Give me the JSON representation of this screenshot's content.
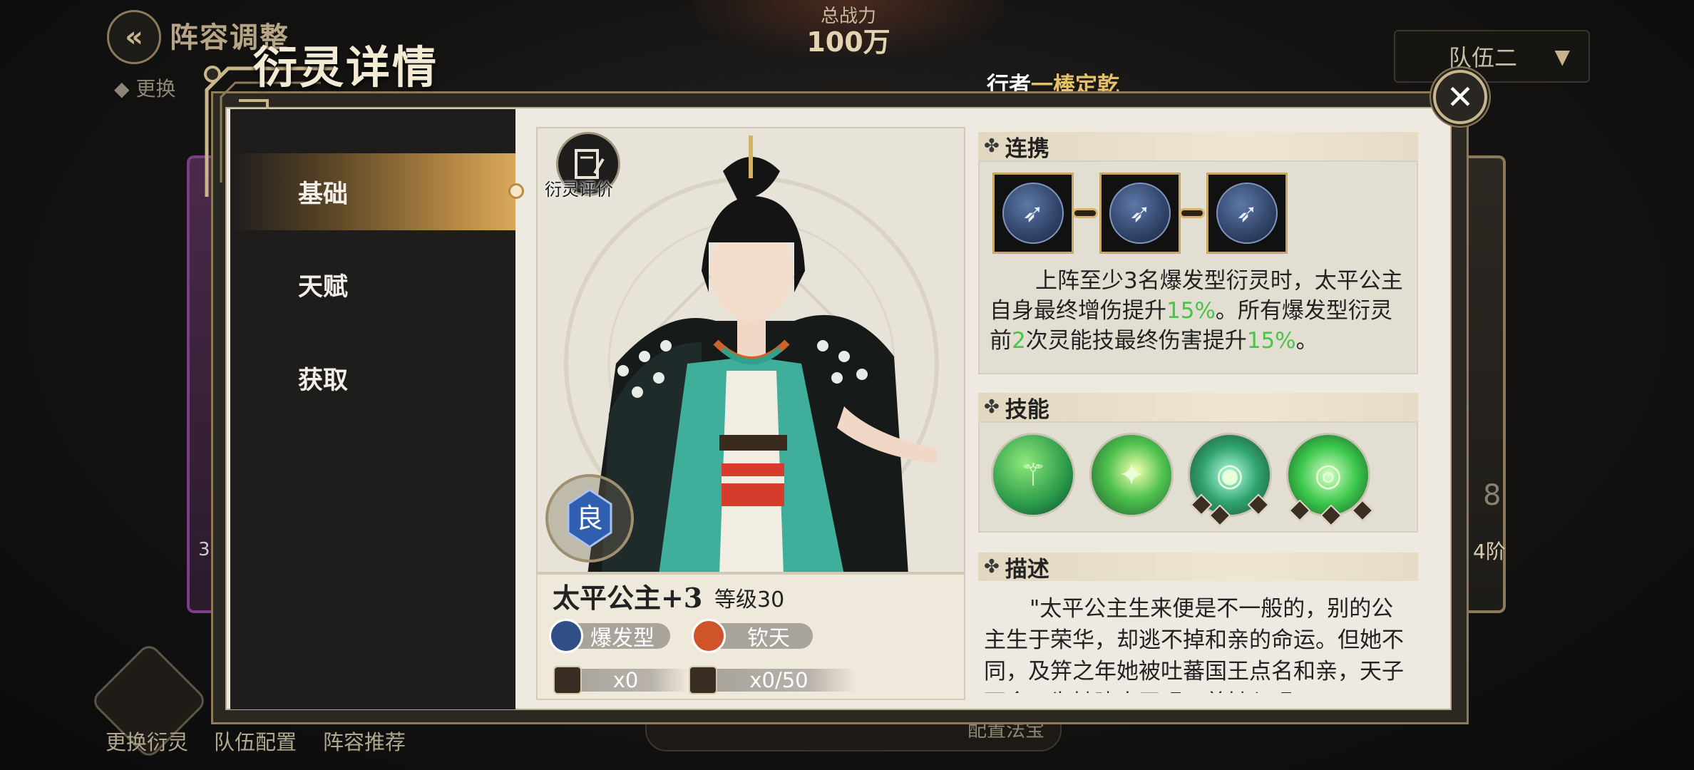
{
  "background": {
    "title": "阵容调整",
    "warning_text": "更换",
    "power_label": "总战力",
    "power_value": "100万",
    "team_selector": "队伍二",
    "hint_prefix": "行者",
    "hint_highlight": "一棒定乾",
    "side_left_number": "3",
    "side_right_number": "8",
    "side_right_text": "4阶",
    "bottom_buttons": [
      "更换衍灵",
      "队伍配置",
      "阵容推荐"
    ],
    "bottom_bar_label": "配置法宝"
  },
  "modal": {
    "title": "衍灵详情",
    "close_icon": "close-icon",
    "nav": [
      {
        "label": "基础",
        "active": true
      },
      {
        "label": "天赋",
        "active": false
      },
      {
        "label": "获取",
        "active": false
      }
    ],
    "portrait": {
      "eval_label": "衍灵评价",
      "rank_badge": "良",
      "name": "太平公主+3",
      "level": "等级30",
      "tags": [
        {
          "label": "爆发型",
          "icon": "burst-type-icon",
          "color": "#2f4f86"
        },
        {
          "label": "钦天",
          "icon": "qintian-faction-icon",
          "color": "#d0542a"
        }
      ],
      "resources": [
        {
          "value": "x0",
          "icon": "character-shard-icon"
        },
        {
          "value": "x0/50",
          "icon": "character-token-icon"
        }
      ]
    },
    "sections": {
      "link": {
        "title": "连携",
        "tiles": 3,
        "text_parts": [
          "上阵至少3名爆发型衍灵时，太平公主自身最终增伤提升",
          "15%",
          "。所有爆发型衍灵前",
          "2",
          "次灵能技最终伤害提升",
          "15%",
          "。"
        ]
      },
      "skills": {
        "title": "技能",
        "icons": [
          "skill-staff-icon",
          "skill-burst-icon",
          "skill-orb-icon",
          "skill-target-icon"
        ],
        "level_dots": [
          0,
          0,
          3,
          3
        ]
      },
      "description": {
        "title": "描述",
        "text": "\"太平公主生来便是不一般的，别的公主生于荣华，却逃不掉和亲的命运。但她不同，及笄之年她被吐蕃国王点名和亲，天子不舍，为她建太平观，着她入观"
      }
    }
  },
  "colors": {
    "accent_gold": "#c9b68d",
    "highlight_green": "#49c34a",
    "panel_bg": "#eeeae1"
  }
}
